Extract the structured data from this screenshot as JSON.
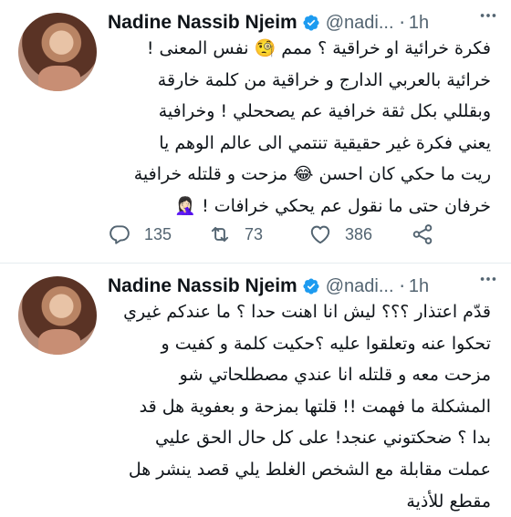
{
  "tweets": [
    {
      "author_name": "Nadine Nassib Njeim",
      "handle": "@nadi...",
      "time": "1h",
      "lines": [
        "فكرة خرائية او خراقية ؟ ممم 🧐 نفس المعنى !",
        "خرائية بالعربي الدارج و خراقية من كلمة خارقة",
        "وبقللي بكل ثقة خرافية عم يصححلي ! وخرافية",
        "يعني فكرة غير حقيقية تنتمي الى عالم الوهم يا",
        "ريت ما حكي كان احسن 😂 مزحت و قلتله خرافية",
        "خرفان حتى ما نقول عم يحكي خرافات ! 🤦🏻‍♀️"
      ],
      "stats": {
        "replies": "135",
        "retweets": "73",
        "likes": "386"
      }
    },
    {
      "author_name": "Nadine Nassib Njeim",
      "handle": "@nadi...",
      "time": "1h",
      "lines": [
        "قدّم اعتذار ؟؟؟ ليش انا اهنت حدا ؟ ما عندكم غيري",
        "تحكوا عنه وتعلقوا عليه ؟حكيت كلمة و كفيت و",
        "مزحت معه و قلتله انا عندي مصطلحاتي شو",
        "المشكلة ما فهمت !! قلتها بمزحة و بعفوية هل قد",
        "بدا ؟ ضحكتوني عنجد! على كل حال الحق عليي",
        "عملت مقابلة مع الشخص الغلط يلي قصد ينشر هل",
        "مقطع للأذية"
      ]
    }
  ],
  "icons": {
    "verified": "verified-badge-icon",
    "more": "more-icon",
    "reply": "reply-icon",
    "retweet": "retweet-icon",
    "like": "like-icon",
    "share": "share-icon"
  },
  "colors": {
    "verified": "#1d9bf0",
    "secondary_text": "#536471",
    "divider": "#e6ecf0"
  }
}
